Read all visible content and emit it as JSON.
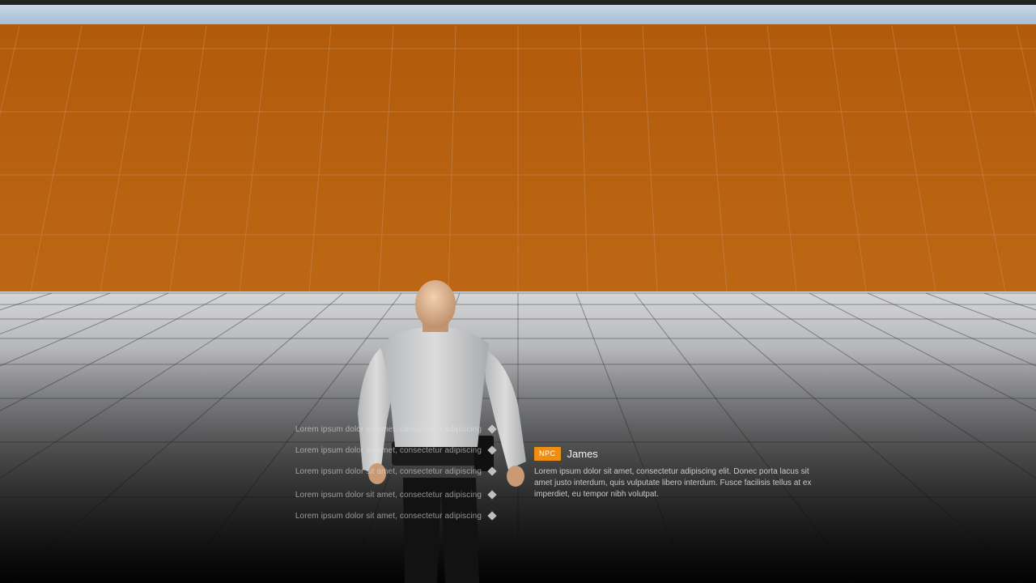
{
  "dialogue": {
    "options": [
      {
        "text": "Lorem ipsum dolor sit amet, consectetur adipiscing"
      },
      {
        "text": "Lorem ipsum dolor sit amet, consectetur adipiscing"
      },
      {
        "text": "Lorem ipsum dolor sit amet, consectetur adipiscing"
      },
      {
        "text": "Lorem ipsum dolor sit amet, consectetur adipiscing"
      },
      {
        "text": "Lorem ipsum dolor sit amet, consectetur adipiscing"
      }
    ]
  },
  "npc": {
    "badge": "NPC",
    "name": "James",
    "text": "Lorem ipsum dolor sit amet, consectetur adipiscing elit. Donec porta lacus sit amet justo interdum, quis vulputate libero interdum. Fusce facilisis tellus at ex imperdiet, eu tempor nibh volutpat."
  },
  "colors": {
    "accent": "#ee8f14",
    "wall": "#b5600e",
    "sky": "#b8cde0"
  },
  "icons": {
    "option_marker": "diamond-icon"
  }
}
